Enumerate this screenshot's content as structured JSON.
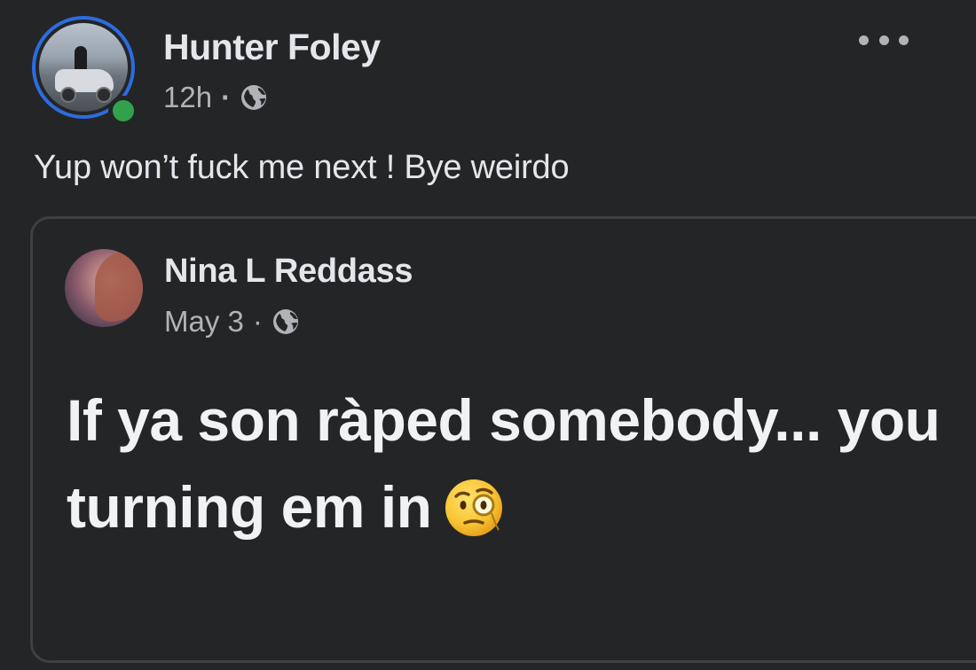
{
  "post": {
    "author": "Hunter Foley",
    "time": "12h",
    "separator": "·",
    "audience_icon": "globe-icon",
    "more_icon": "more-options-icon",
    "caption": "Yup won’t fuck me next ! Bye weirdo"
  },
  "shared": {
    "author": "Nina L Reddass",
    "date": "May 3",
    "separator": "·",
    "audience_icon": "globe-icon",
    "text": "If ya son ràped somebody... you turning em in",
    "emoji": "face-with-monocle-icon"
  },
  "colors": {
    "background": "#242526",
    "text_primary": "#e4e6eb",
    "text_secondary": "#b0b3b8",
    "story_ring": "#2d6ce0",
    "online": "#31a24c",
    "card_border": "#3e4042"
  }
}
